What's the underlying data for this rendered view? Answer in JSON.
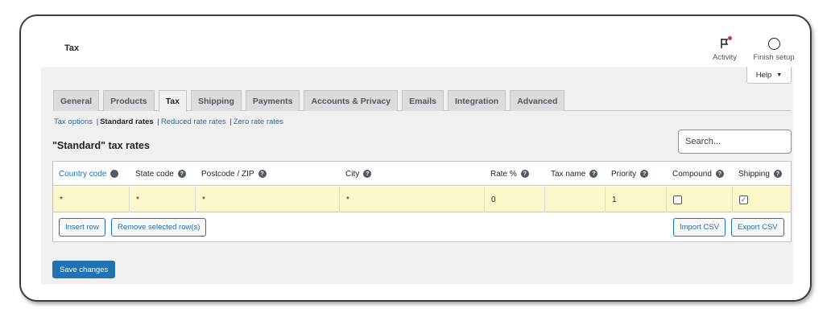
{
  "topbar": {
    "title": "Tax",
    "activity_label": "Activity",
    "finish_setup_label": "Finish setup"
  },
  "help": {
    "label": "Help"
  },
  "tabs": [
    {
      "label": "General"
    },
    {
      "label": "Products"
    },
    {
      "label": "Tax",
      "active": true
    },
    {
      "label": "Shipping"
    },
    {
      "label": "Payments"
    },
    {
      "label": "Accounts & Privacy"
    },
    {
      "label": "Emails"
    },
    {
      "label": "Integration"
    },
    {
      "label": "Advanced"
    }
  ],
  "subnav": {
    "tax_options": "Tax options",
    "standard_rates": "Standard rates",
    "reduced_rates": "Reduced rate rates",
    "zero_rates": "Zero rate rates"
  },
  "heading": "\"Standard\" tax rates",
  "search": {
    "placeholder": "Search..."
  },
  "table": {
    "columns": [
      "Country code",
      "State code",
      "Postcode / ZIP",
      "City",
      "Rate %",
      "Tax name",
      "Priority",
      "Compound",
      "Shipping"
    ],
    "row": {
      "country": "*",
      "state": "*",
      "postcode": "*",
      "city": "*",
      "rate": "0",
      "tax_name": "",
      "priority": "1",
      "compound": false,
      "shipping": true
    }
  },
  "buttons": {
    "insert_row": "Insert row",
    "remove_rows": "Remove selected row(s)",
    "import_csv": "Import CSV",
    "export_csv": "Export CSV",
    "save_changes": "Save changes"
  },
  "colors": {
    "accent": "#2271b1",
    "highlight_row": "#fbf9c9",
    "notification_dot": "#d63638"
  }
}
